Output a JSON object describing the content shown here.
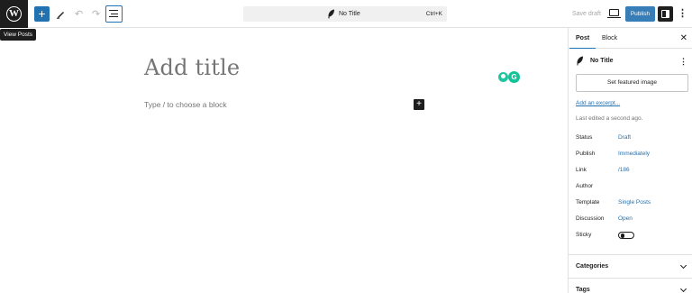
{
  "topbar": {
    "logo": "W",
    "tooltip": "View Posts",
    "add_block_symbol": "+",
    "undo_symbol": "↶",
    "redo_symbol": "↷",
    "command_title": "No Title",
    "command_shortcut": "Ctrl+K",
    "save_draft": "Save draft",
    "publish": "Publish",
    "more_symbol": "⋮"
  },
  "editor": {
    "title_placeholder": "Add title",
    "block_placeholder": "Type / to choose a block",
    "block_add_symbol": "+",
    "extension_letter": "G"
  },
  "sidebar": {
    "tabs": {
      "post": "Post",
      "block": "Block"
    },
    "close_symbol": "✕",
    "post_title": "No Title",
    "post_menu_symbol": "⋮",
    "featured_image": "Set featured image",
    "excerpt_link": "Add an excerpt...",
    "last_edited": "Last edited a second ago.",
    "meta": [
      {
        "label": "Status",
        "value": "Draft"
      },
      {
        "label": "Publish",
        "value": "Immediately"
      },
      {
        "label": "Link",
        "value": "/186"
      },
      {
        "label": "Author",
        "value": ""
      },
      {
        "label": "Template",
        "value": "Single Posts"
      },
      {
        "label": "Discussion",
        "value": "Open"
      },
      {
        "label": "Sticky",
        "value": ""
      }
    ],
    "panels": {
      "categories": "Categories",
      "tags": "Tags"
    }
  },
  "colors": {
    "accent": "#2271b1",
    "dark": "#1e1e1e",
    "placeholder": "#757575",
    "extension": "#15c39a"
  },
  "icons": [
    "wordpress-icon",
    "plus-icon",
    "pen-tool-icon",
    "undo-icon",
    "redo-icon",
    "list-view-icon",
    "feather-icon",
    "desktop-preview-icon",
    "sidebar-settings-icon",
    "more-vertical-icon",
    "close-icon",
    "chevron-down-icon",
    "grammarly-icon",
    "location-pin-icon"
  ],
  "toggle": {
    "sticky_on": false
  }
}
